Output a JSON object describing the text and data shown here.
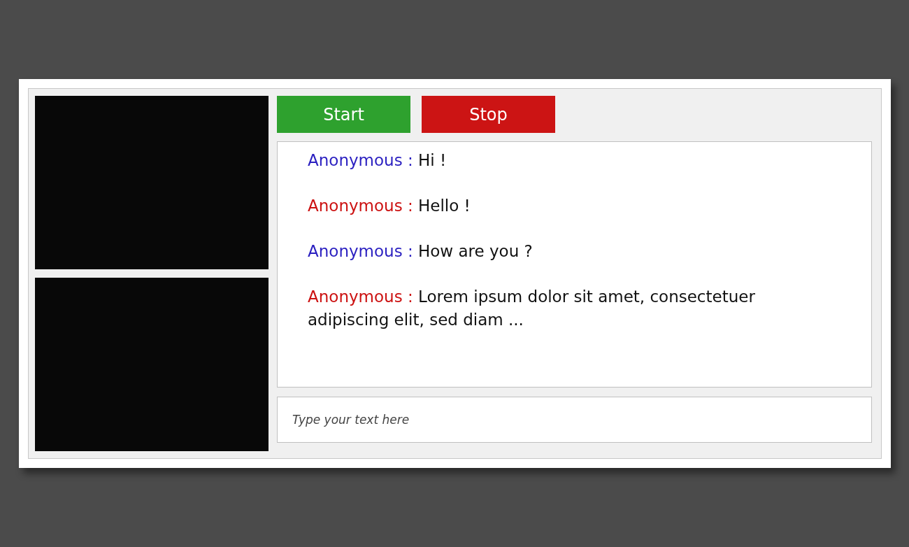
{
  "buttons": [
    {
      "label": "Start",
      "kind": "start"
    },
    {
      "label": "Stop",
      "kind": "stop"
    }
  ],
  "messages": [
    {
      "sender": "Anonymous :",
      "text": "Hi !",
      "color": "#2a1fc0"
    },
    {
      "sender": "Anonymous :",
      "text": "Hello !",
      "color": "#cc1111"
    },
    {
      "sender": "Anonymous :",
      "text": "How are you ?",
      "color": "#2a1fc0"
    },
    {
      "sender": "Anonymous :",
      "text": "Lorem ipsum dolor sit amet, consectetuer adipiscing elit, sed diam ...",
      "color": "#cc1111"
    }
  ],
  "input": {
    "placeholder": "Type your text here"
  }
}
